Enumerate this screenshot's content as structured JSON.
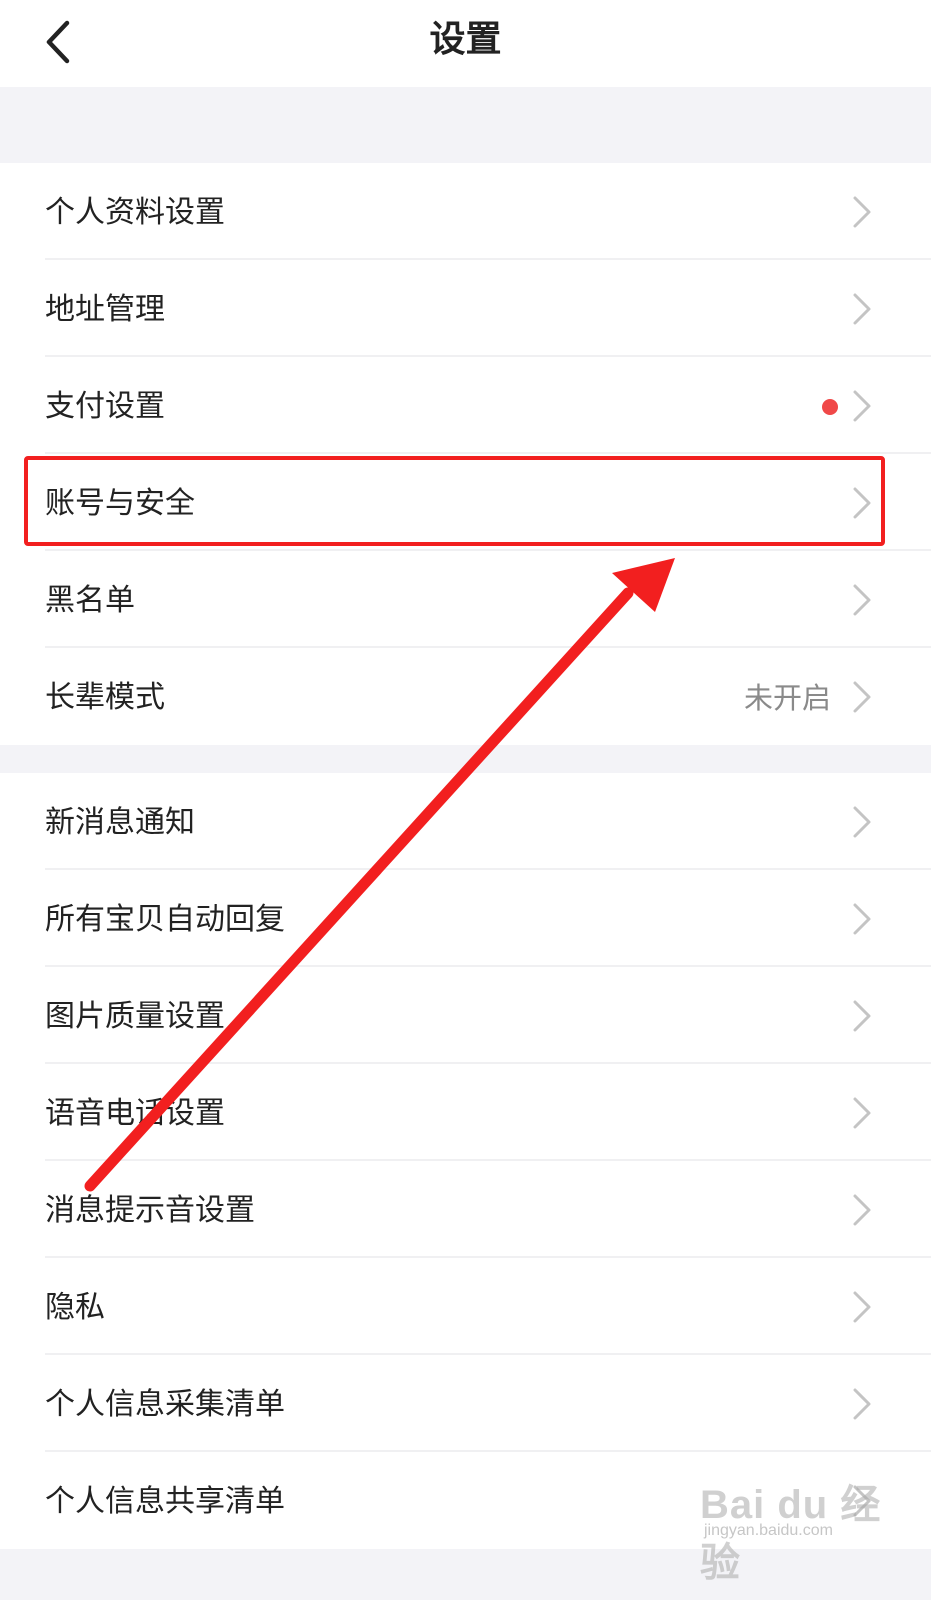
{
  "header": {
    "title": "设置",
    "back_icon": "chevron-left-icon"
  },
  "group1": [
    {
      "label": "个人资料设置"
    },
    {
      "label": "地址管理"
    },
    {
      "label": "支付设置",
      "badge": "red-dot"
    },
    {
      "label": "账号与安全",
      "highlighted": true
    },
    {
      "label": "黑名单"
    },
    {
      "label": "长辈模式",
      "status": "未开启"
    }
  ],
  "group2": [
    {
      "label": "新消息通知"
    },
    {
      "label": "所有宝贝自动回复"
    },
    {
      "label": "图片质量设置"
    },
    {
      "label": "语音电话设置"
    },
    {
      "label": "消息提示音设置"
    },
    {
      "label": "隐私"
    },
    {
      "label": "个人信息采集清单"
    },
    {
      "label": "个人信息共享清单"
    }
  ],
  "annotation": {
    "color": "#f21f1f",
    "type": "arrow-pointing-to-highlighted-row"
  },
  "watermark": {
    "main": "Bai du 经验",
    "sub": "jingyan.baidu.com"
  },
  "colors": {
    "background": "#f3f3f7",
    "text": "#222222",
    "secondary_text": "#8a8a8a",
    "chevron": "#c4c4c4",
    "red_dot": "#f04848",
    "annotation_red": "#f21f1f"
  }
}
